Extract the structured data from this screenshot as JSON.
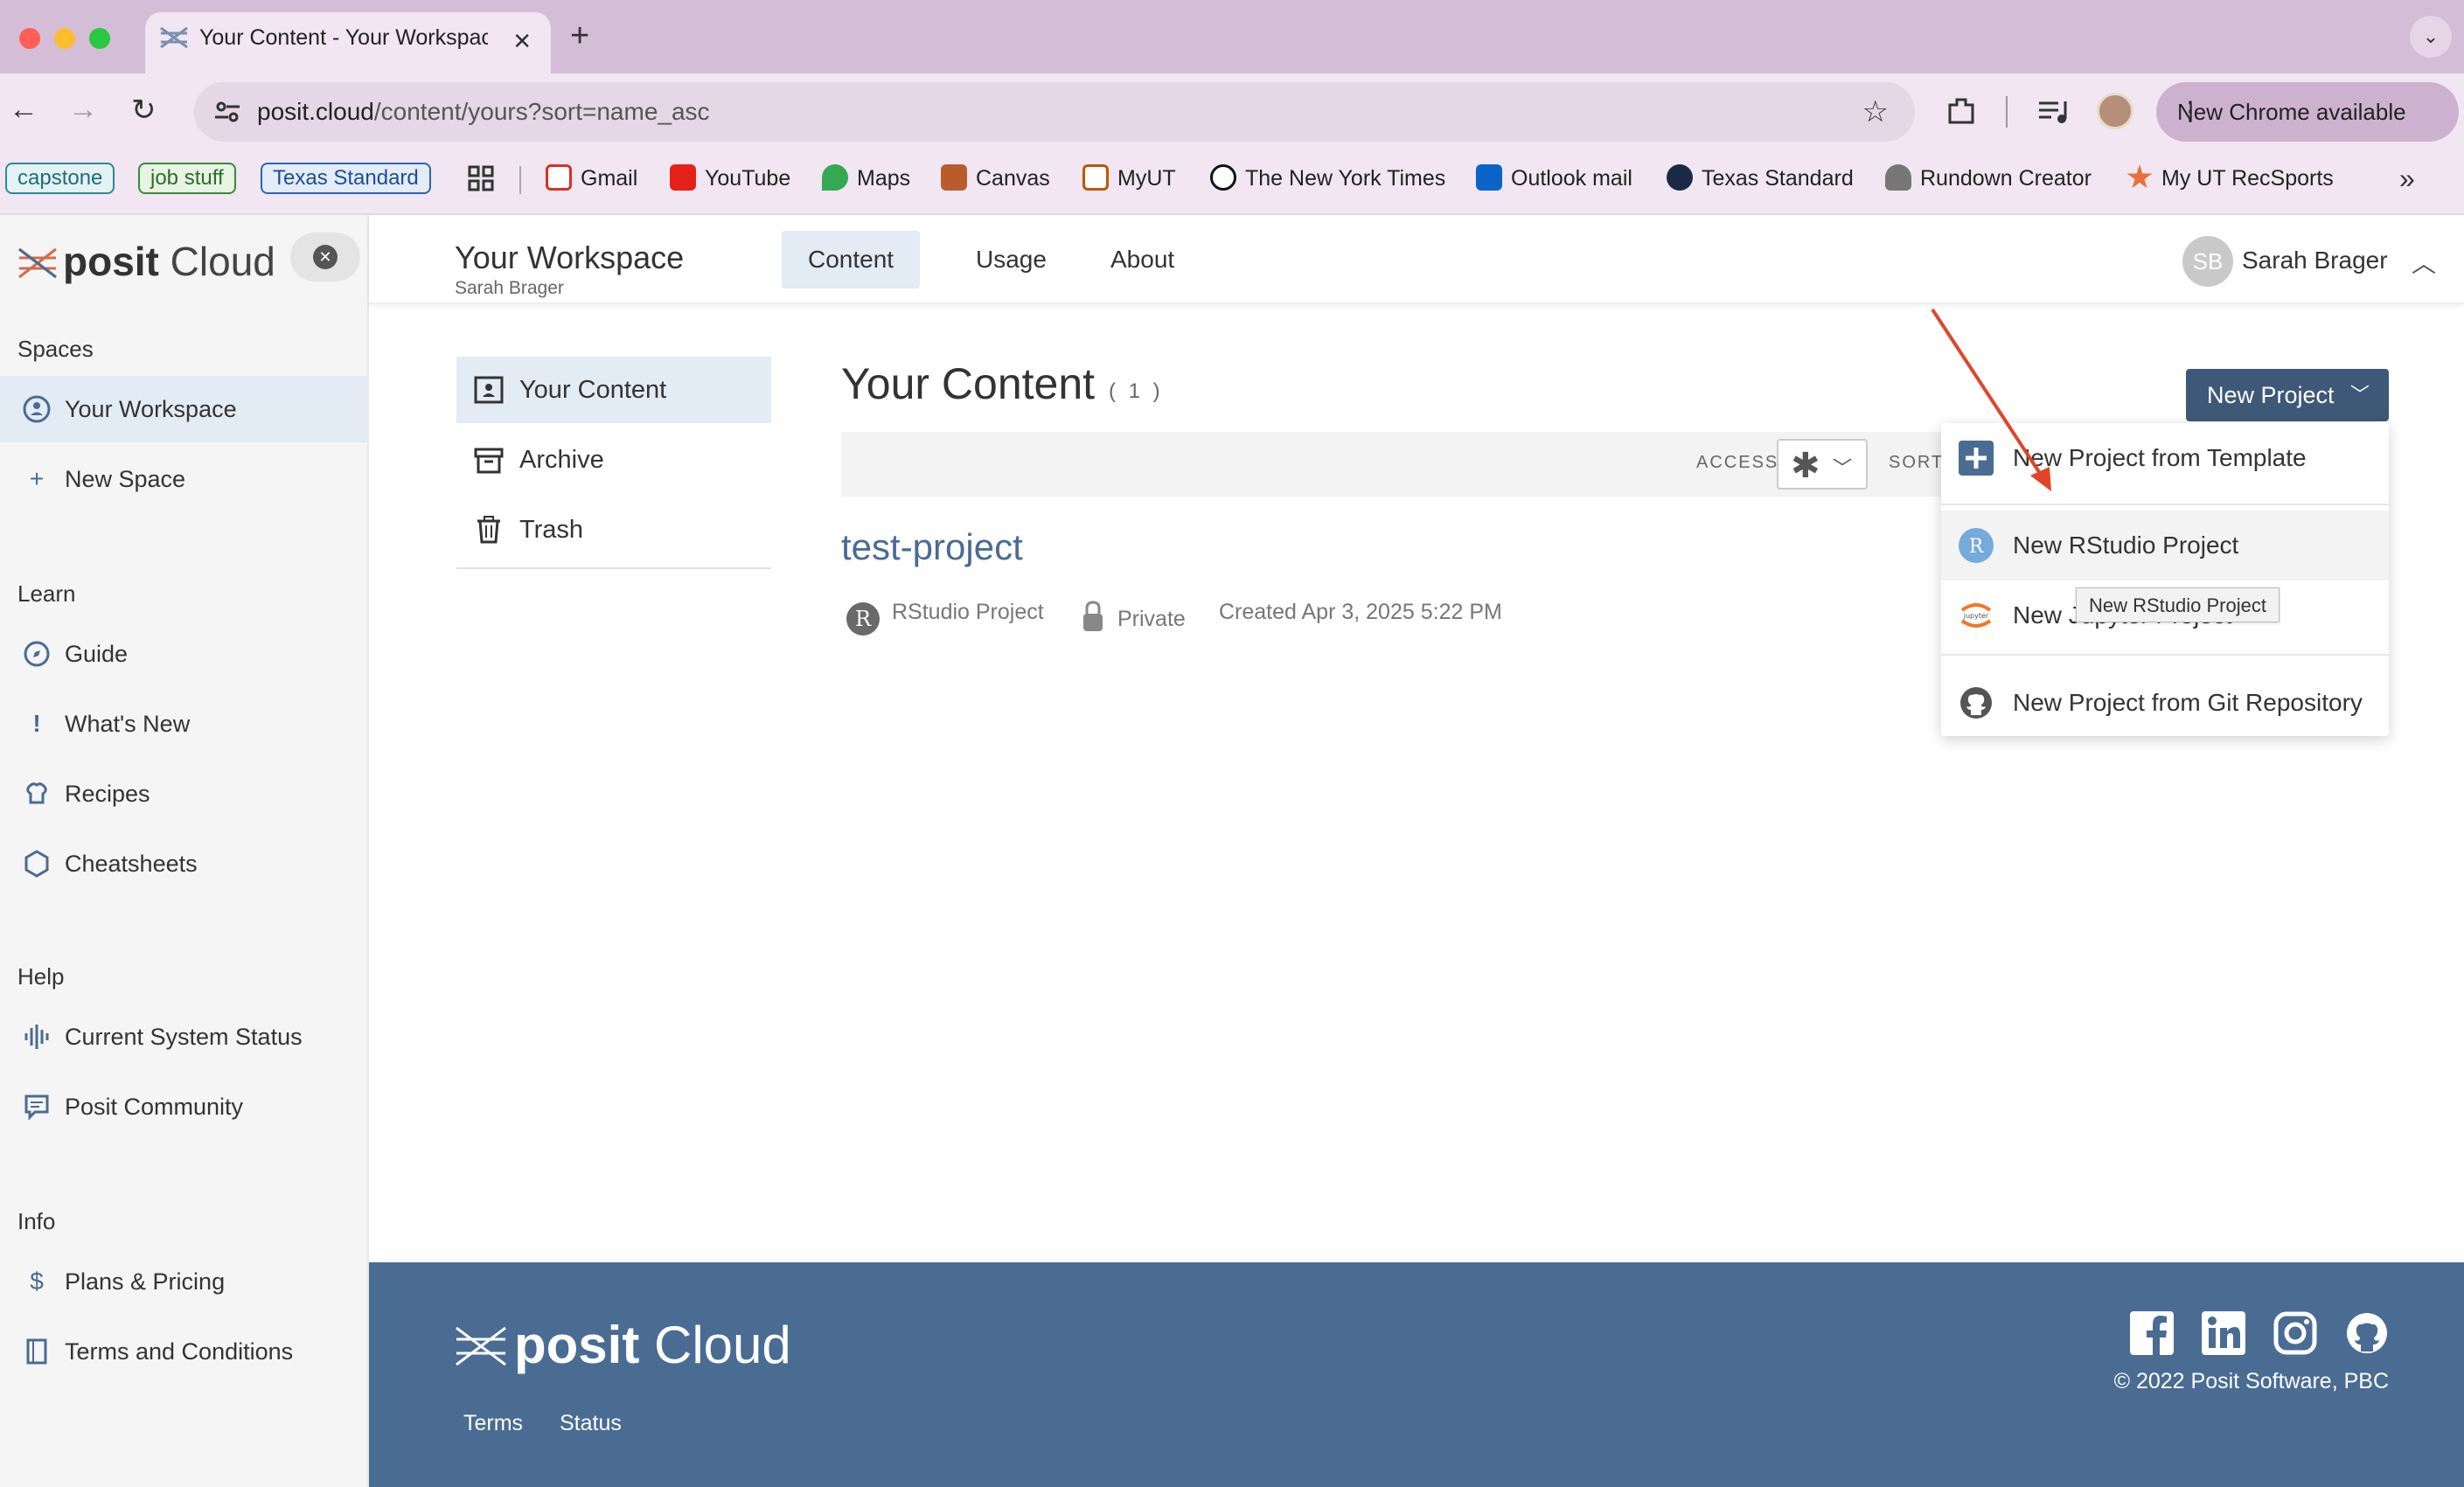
{
  "browser": {
    "tab_title": "Your Content - Your Workspace",
    "url_host": "posit.cloud",
    "url_path": "/content/yours?sort=name_asc",
    "update_label": "New Chrome available",
    "bookmark_tags": [
      "capstone",
      "job stuff",
      "Texas Standard"
    ],
    "bookmarks": [
      "Gmail",
      "YouTube",
      "Maps",
      "Canvas",
      "MyUT",
      "The New York Times",
      "Outlook mail",
      "Texas Standard",
      "Rundown Creator",
      "My UT RecSports"
    ],
    "colors": {
      "tabstrip": "#d4bdd6",
      "toolbar": "#f1e6f2"
    }
  },
  "sidebar": {
    "logo_brand": "posit",
    "logo_product": "Cloud",
    "sections": [
      {
        "heading": "Spaces",
        "items": [
          {
            "label": "Your Workspace",
            "icon": "person-circle-icon"
          },
          {
            "label": "New Space",
            "icon": "plus-icon"
          }
        ]
      },
      {
        "heading": "Learn",
        "items": [
          {
            "label": "Guide",
            "icon": "compass-icon"
          },
          {
            "label": "What's New",
            "icon": "exclamation-icon"
          },
          {
            "label": "Recipes",
            "icon": "chef-hat-icon"
          },
          {
            "label": "Cheatsheets",
            "icon": "hexagon-icon"
          }
        ]
      },
      {
        "heading": "Help",
        "items": [
          {
            "label": "Current System Status",
            "icon": "pulse-icon"
          },
          {
            "label": "Posit Community",
            "icon": "chat-icon"
          }
        ]
      },
      {
        "heading": "Info",
        "items": [
          {
            "label": "Plans & Pricing",
            "icon": "dollar-icon"
          },
          {
            "label": "Terms and Conditions",
            "icon": "document-icon"
          }
        ]
      }
    ]
  },
  "header": {
    "workspace_title": "Your Workspace",
    "workspace_owner": "Sarah Brager",
    "tabs": [
      "Content",
      "Usage",
      "About"
    ],
    "user_initials": "SB",
    "user_name": "Sarah Brager"
  },
  "content_nav": [
    "Your Content",
    "Archive",
    "Trash"
  ],
  "main": {
    "title": "Your Content",
    "count": "( 1 )",
    "access_label": "ACCESS",
    "access_value": "✱",
    "sort_label": "SORT",
    "new_project_label": "New Project",
    "project": {
      "name": "test-project",
      "type": "RStudio Project",
      "type_badge": "R",
      "access": "Private",
      "created": "Created Apr 3, 2025 5:22 PM"
    }
  },
  "dropdown": {
    "items": [
      "New Project from Template",
      "New RStudio Project",
      "New Jupyter Project",
      "New Project from Git Repository"
    ],
    "tooltip": "New RStudio Project"
  },
  "footer": {
    "logo_brand": "posit",
    "logo_product": "Cloud",
    "links": [
      "Terms",
      "Status"
    ],
    "copyright": "© 2022 Posit Software, PBC",
    "social": [
      "facebook-icon",
      "linkedin-icon",
      "instagram-icon",
      "github-icon"
    ]
  },
  "accent_color": "#4a6c93"
}
